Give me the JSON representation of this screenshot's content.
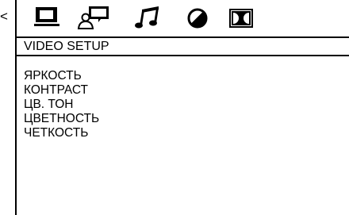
{
  "left_edge_mark": "<",
  "icon_bar": [
    {
      "icon": "monitor-icon",
      "label": "General setup"
    },
    {
      "icon": "speaker-person-icon",
      "label": "Speaker setup"
    },
    {
      "icon": "music-note-icon",
      "label": "Audio setup"
    },
    {
      "icon": "circle-slash-icon",
      "label": "Video setup"
    },
    {
      "icon": "dolby-icon",
      "label": "Dolby setup"
    }
  ],
  "page_title": "VIDEO SETUP",
  "menu_items": [
    "ЯРКОСТЬ",
    "КОНТРАСТ",
    "ЦВ. ТОН",
    "ЦВЕТНОСТЬ",
    "ЧЕТКОСТЬ"
  ]
}
